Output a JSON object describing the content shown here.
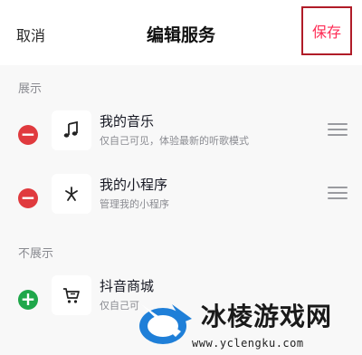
{
  "header": {
    "cancel_label": "取消",
    "title": "编辑服务",
    "save_label": "保存"
  },
  "sections": {
    "shown": {
      "label": "展示",
      "items": [
        {
          "name": "我的音乐",
          "desc": "仅自己可见，体验最新的听歌模式",
          "icon": "music-note-icon",
          "action": "remove"
        },
        {
          "name": "我的小程序",
          "desc": "管理我的小程序",
          "icon": "mini-program-icon",
          "action": "remove"
        }
      ]
    },
    "hidden": {
      "label": "不展示",
      "items": [
        {
          "name": "抖音商城",
          "desc": "仅自己可",
          "icon": "shopping-cart-icon",
          "action": "add"
        }
      ]
    }
  },
  "watermark": {
    "name": "冰棱游戏网",
    "url": "www.yclengku.com"
  },
  "colors": {
    "accent": "#fe2c55",
    "remove": "#e03a3e",
    "add": "#1fa74a",
    "highlight_border": "#b01c28"
  }
}
